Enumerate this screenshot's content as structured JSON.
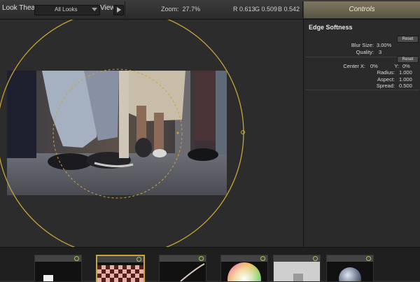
{
  "toolbar": {
    "app_title": "Look Theater",
    "looks_select": "All Looks",
    "view_label": "View",
    "zoom_label": "Zoom:",
    "zoom_value": "27.7%",
    "r_label": "R",
    "r_value": "0.613",
    "g_label": "G",
    "g_value": "0.509",
    "b_label": "B",
    "b_value": "0.542"
  },
  "controls": {
    "header": "Controls",
    "title": "Edge Softness",
    "reset_label": "Reset",
    "blur_size_label": "Blur Size:",
    "blur_size_value": "3.00",
    "blur_size_unit": "%",
    "quality_label": "Quality:",
    "quality_value": "3",
    "center_x_label": "Center X:",
    "center_x_value": "0%",
    "center_y_label": "Y:",
    "center_y_value": "0%",
    "radius_label": "Radius:",
    "radius_value": "1.000",
    "aspect_label": "Aspect:",
    "aspect_value": "1.000",
    "spread_label": "Spread:",
    "spread_value": "0.500"
  },
  "colors": {
    "accent_gold": "#c9a43a",
    "power_green": "#a7c75a"
  },
  "tray": {
    "thumbnails": [
      "text-preview",
      "checkerboard",
      "gradient-swoosh",
      "color-wheel",
      "letter-preview",
      "sphere"
    ]
  }
}
